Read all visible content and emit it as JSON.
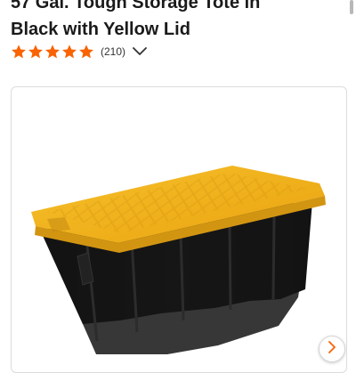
{
  "product": {
    "title_line1": "57 Gal. Tough Storage Tote in",
    "title_line2": "Black with Yellow Lid",
    "rating": {
      "stars": 5,
      "count_text": "(210)"
    }
  },
  "icons": {
    "star": "star-icon",
    "chevron": "chevron-down-icon",
    "next": "chevron-right-icon"
  },
  "colors": {
    "star": "#f96302",
    "lid": "#f2b11a",
    "tote": "#151515",
    "chevron": "#f96302"
  },
  "image": {
    "alt": "Black storage tote with yellow lid"
  }
}
